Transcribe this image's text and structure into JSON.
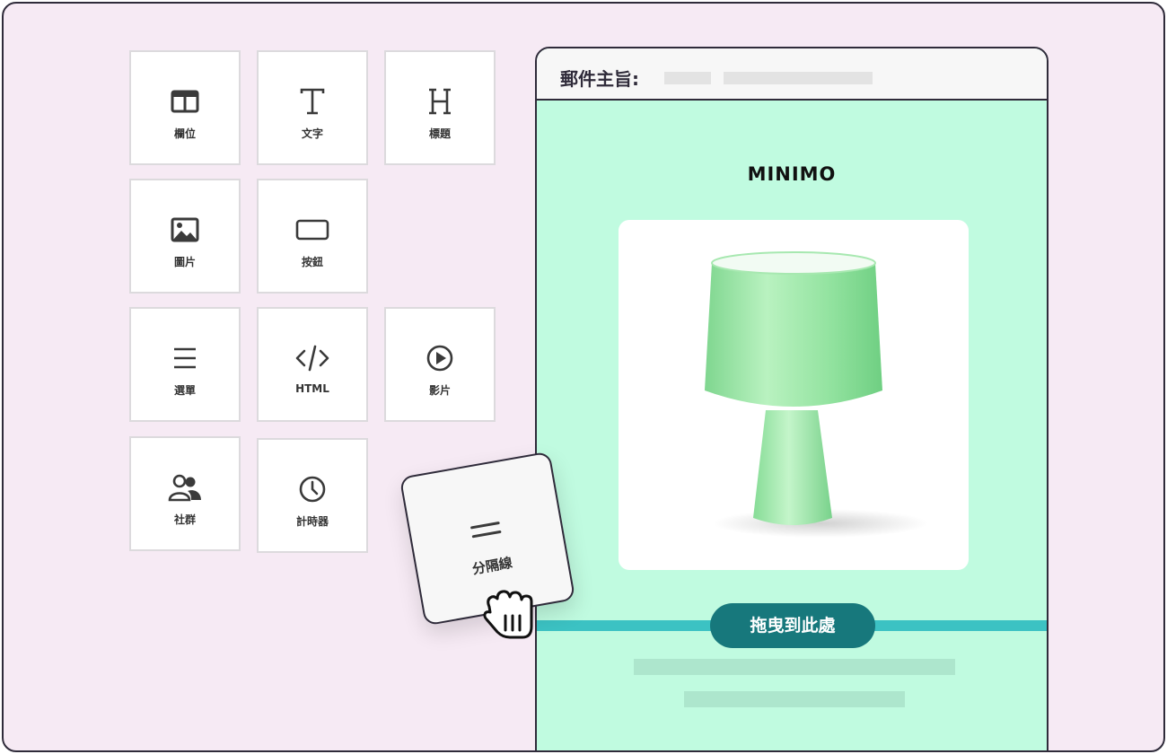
{
  "palette": [
    {
      "key": "columns",
      "label": "欄位",
      "icon": "columns-icon"
    },
    {
      "key": "text",
      "label": "文字",
      "icon": "text-icon"
    },
    {
      "key": "heading",
      "label": "標題",
      "icon": "heading-icon"
    },
    {
      "key": "image",
      "label": "圖片",
      "icon": "image-icon"
    },
    {
      "key": "button",
      "label": "按鈕",
      "icon": "button-icon"
    },
    {
      "key": "menu",
      "label": "選單",
      "icon": "menu-icon"
    },
    {
      "key": "html",
      "label": "HTML",
      "icon": "code-icon"
    },
    {
      "key": "video",
      "label": "影片",
      "icon": "play-icon"
    },
    {
      "key": "social",
      "label": "社群",
      "icon": "users-icon"
    },
    {
      "key": "timer",
      "label": "計時器",
      "icon": "clock-icon"
    }
  ],
  "dragged_block": {
    "label": "分隔線",
    "icon": "divider-icon"
  },
  "email": {
    "subject_label": "郵件主旨:",
    "brand": "MINIMO",
    "drop_hint": "拖曳到此處"
  },
  "colors": {
    "background": "#f6eaf4",
    "email_bg": "#c0fbe0",
    "drop_line": "#3cc2c3",
    "drop_button": "#17787c",
    "lamp": "#9ee6a6"
  }
}
